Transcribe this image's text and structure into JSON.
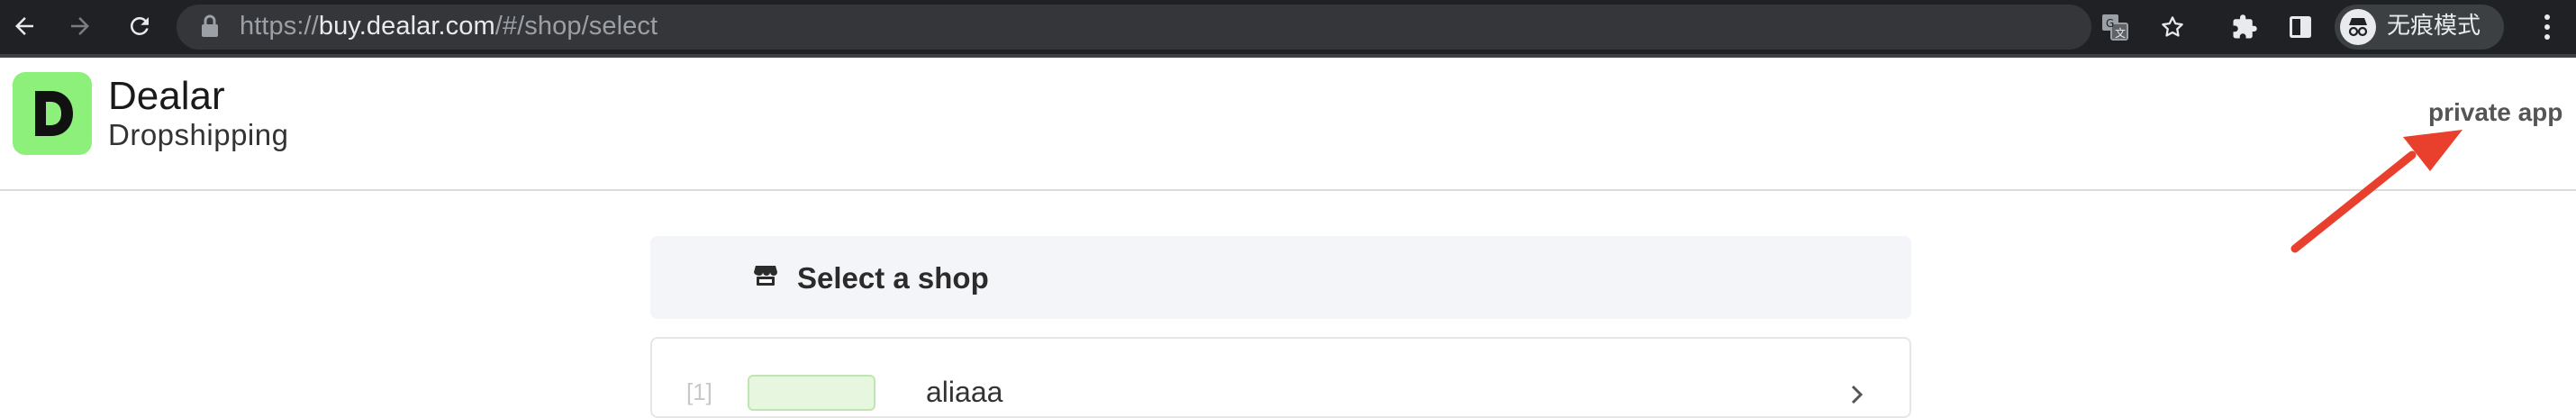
{
  "browser": {
    "url_scheme": "https://",
    "url_host": "buy.dealar.com",
    "url_path": "/#/shop/select",
    "incognito_label": "无痕模式",
    "icons": [
      "back-icon",
      "forward-icon",
      "reload-icon",
      "lock-icon",
      "translate-icon",
      "star-icon",
      "extensions-icon",
      "side-panel-icon",
      "incognito-icon",
      "more-icon"
    ]
  },
  "header": {
    "brand_title": "Dealar",
    "brand_subtitle": "Dropshipping",
    "logo_letter": "D",
    "private_app_label": "private app",
    "logo_color": "#8cf07a",
    "annotation_arrow_color": "#e8402d"
  },
  "main": {
    "select_title": "Select a shop",
    "shops": [
      {
        "index": "[1]",
        "tag": "",
        "name": "aliaaa"
      }
    ]
  }
}
